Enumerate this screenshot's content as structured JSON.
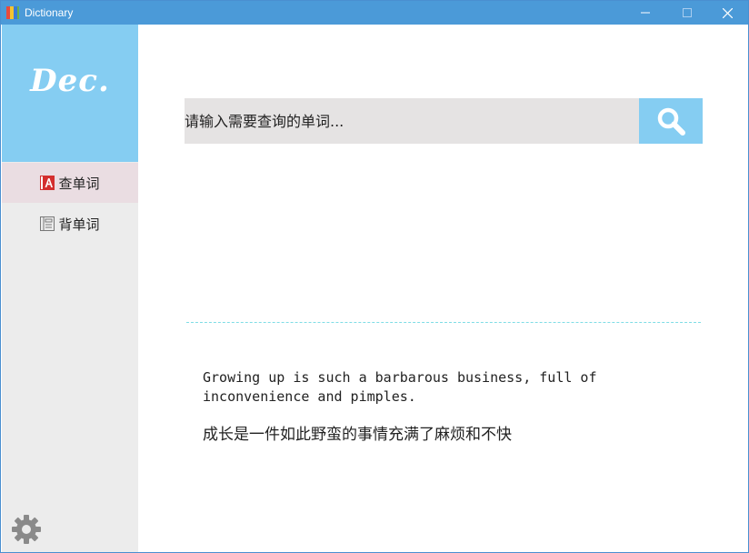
{
  "window": {
    "title": "Dictionary",
    "controls": {
      "minimize": "—",
      "maximize": "☐",
      "close": "✕"
    }
  },
  "sidebar": {
    "logo": "Dec.",
    "items": [
      {
        "label": "查单词",
        "icon": "dictionary-a-icon",
        "active": true
      },
      {
        "label": "背单词",
        "icon": "notebook-icon",
        "active": false
      }
    ],
    "settings_icon": "gear-icon"
  },
  "search": {
    "placeholder": "请输入需要查询的单词...",
    "button_icon": "search-icon"
  },
  "quote": {
    "english": "Growing up is such a barbarous business, full of inconvenience and pimples.",
    "chinese": "成长是一件如此野蛮的事情充满了麻烦和不快"
  },
  "colors": {
    "accent": "#85cdf2",
    "titlebar": "#4b9ad8",
    "sidebar": "#ececec",
    "active_item": "#eadde2",
    "search_field": "#e5e3e3",
    "divider": "#7fdde6"
  }
}
